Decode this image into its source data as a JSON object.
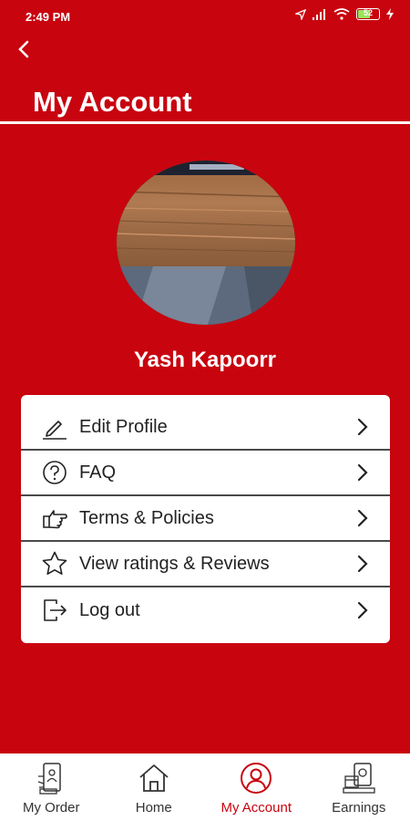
{
  "status_bar": {
    "time": "2:49 PM",
    "battery": "52"
  },
  "header": {
    "title": "My Account"
  },
  "profile": {
    "name": "Yash Kapoorr"
  },
  "menu": {
    "items": [
      {
        "label": "Edit Profile",
        "icon": "edit-icon"
      },
      {
        "label": "FAQ",
        "icon": "help-icon"
      },
      {
        "label": "Terms & Policies",
        "icon": "thumb-icon"
      },
      {
        "label": "View ratings & Reviews",
        "icon": "star-icon"
      },
      {
        "label": "Log out",
        "icon": "logout-icon"
      }
    ]
  },
  "bottom_nav": {
    "active": "My Account",
    "items": [
      {
        "label": "My Order",
        "icon": "order-icon"
      },
      {
        "label": "Home",
        "icon": "home-icon"
      },
      {
        "label": "My Account",
        "icon": "account-icon"
      },
      {
        "label": "Earnings",
        "icon": "earnings-icon"
      }
    ]
  },
  "colors": {
    "primary": "#c8040f",
    "card": "#ffffff",
    "text": "#222222"
  }
}
